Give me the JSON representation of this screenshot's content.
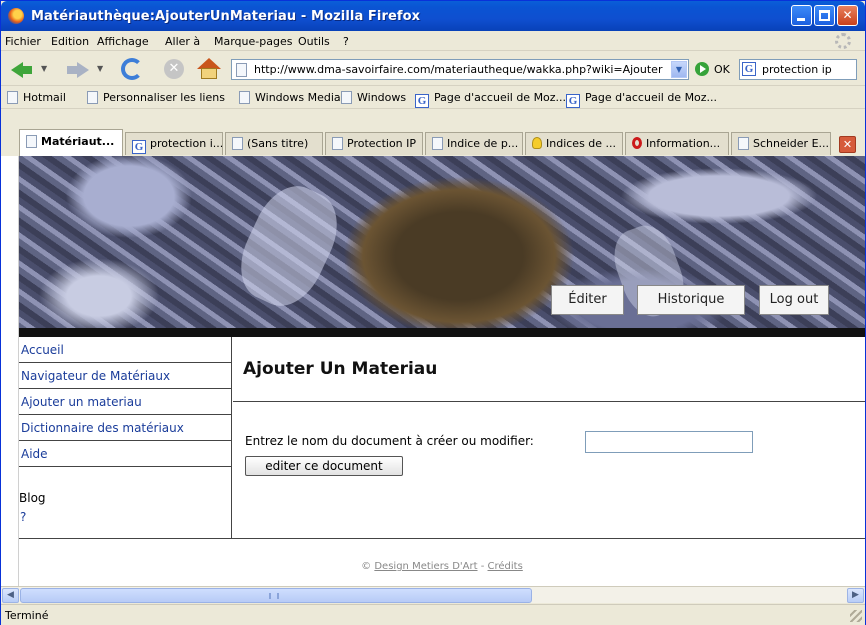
{
  "window": {
    "title": "Matériauthèque:AjouterUnMateriau - Mozilla Firefox"
  },
  "menu": [
    "Fichier",
    "Edition",
    "Affichage",
    "Aller à",
    "Marque-pages",
    "Outils",
    "?"
  ],
  "toolbar": {
    "url": "http://www.dma-savoirfaire.com/materiautheque/wakka.php?wiki=Ajouter",
    "go_label": "OK",
    "search_value": "protection ip"
  },
  "bookmarks": [
    "Hotmail",
    "Personnaliser les liens",
    "Windows Media",
    "Windows",
    "Page d'accueil de Moz...",
    "Page d'accueil de Moz..."
  ],
  "tabs": [
    "Matériaut...",
    "protection i...",
    "(Sans titre)",
    "Protection IP",
    "Indice de p...",
    "Indices de ...",
    "Information...",
    "Schneider E..."
  ],
  "header": {
    "edit": "Éditer",
    "history": "Historique",
    "logout": "Log out"
  },
  "sidebar": {
    "items": [
      "Accueil",
      "Navigateur de Matériaux",
      "Ajouter un materiau",
      "Dictionnaire des matériaux",
      "Aide"
    ],
    "blog": "Blog",
    "question": "?"
  },
  "main": {
    "title": "Ajouter Un Materiau",
    "prompt": "Entrez le nom du document à créer ou modifier:",
    "input_value": "",
    "button": "editer ce document"
  },
  "footer": {
    "copyright": "©",
    "link1": "Design Metiers D'Art",
    "sep": "-",
    "link2": "Crédits"
  },
  "status": "Terminé"
}
